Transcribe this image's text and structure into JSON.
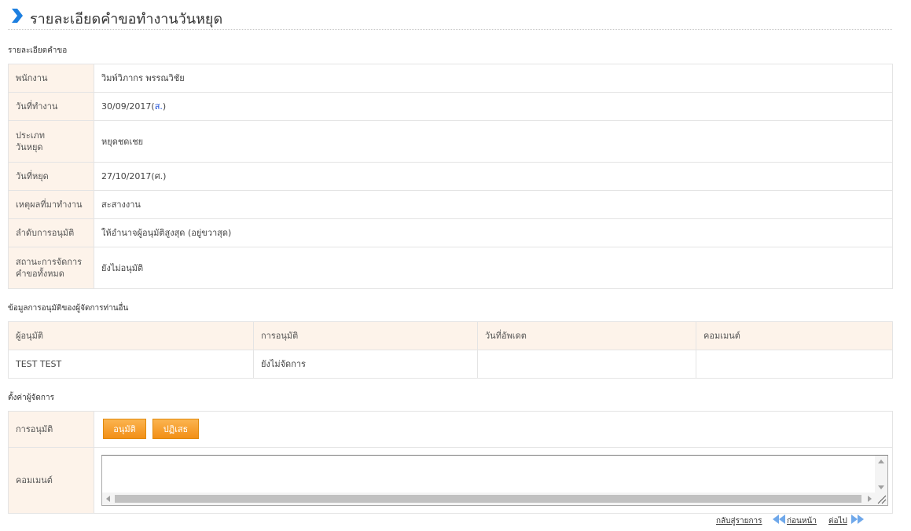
{
  "page": {
    "title": "รายละเอียดคำขอทำงานวันหยุด"
  },
  "details": {
    "section_label": "รายละเอียดคำขอ",
    "rows": [
      {
        "label": "พนักงาน",
        "value": "วิมพ์วิภากร พรรณวิชัย"
      },
      {
        "label": "วันที่ทำงาน",
        "value": "30/09/2017(",
        "value_accent": "ส.",
        "value_suffix": ")"
      },
      {
        "label_line1": "ประเภท",
        "label_line2": "วันหยุด",
        "value": "หยุดชดเชย"
      },
      {
        "label": "วันที่หยุด",
        "value": "27/10/2017(ศ.)"
      },
      {
        "label": "เหตุผลที่มาทำงาน",
        "value": "สะสางงาน"
      },
      {
        "label": "ลำดับการอนุมัติ",
        "value": "ให้อำนาจผู้อนุมัติสูงสุด (อยู่ขวาสุด)"
      },
      {
        "label_line1": "สถานะการจัดการ",
        "label_line2": "คำขอทั้งหมด",
        "value": "ยังไม่อนุมัติ"
      }
    ]
  },
  "approvers": {
    "section_label": "ข้อมูลการอนุมัติของผู้จัดการท่านอื่น",
    "columns": [
      "ผู้อนุมัติ",
      "การอนุมัติ",
      "วันที่อัพเดต",
      "คอมเมนต์"
    ],
    "rows": [
      {
        "approver": "TEST TEST",
        "status": "ยังไม่จัดการ",
        "updated": "",
        "comment": ""
      }
    ]
  },
  "settings": {
    "section_label": "ตั้งค่าผู้จัดการ",
    "approval_label": "การอนุมัติ",
    "approve_button": "อนุมัติ",
    "reject_button": "ปฏิเสธ",
    "comment_label": "คอมเมนต์",
    "comment_value": ""
  },
  "footer": {
    "back_to_list": "กลับสู่รายการ",
    "previous": "ก่อนหน้า",
    "next": "ต่อไป"
  },
  "colors": {
    "accent_blue": "#1d7fe0",
    "label_bg": "#fdf3ea",
    "button_orange": "#f5a12a",
    "nav_arrow": "#6fa8ea"
  }
}
